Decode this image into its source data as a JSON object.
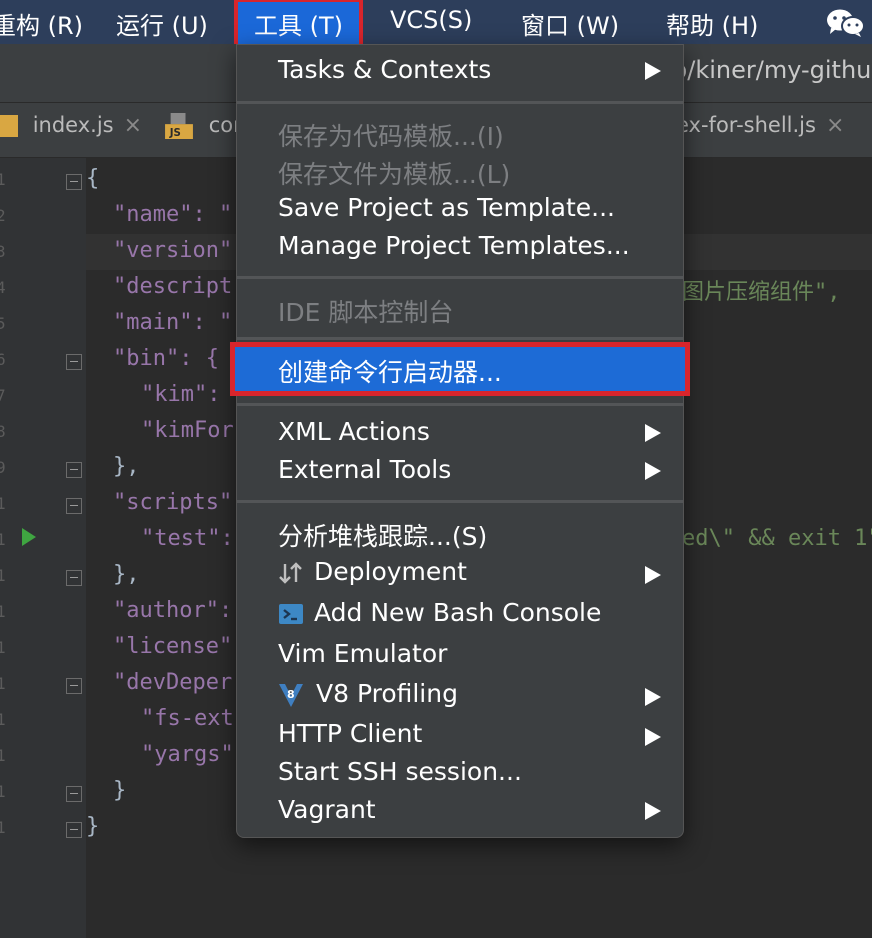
{
  "menubar": {
    "items": [
      {
        "label": "重构 (R)"
      },
      {
        "label": "运行 (U)"
      },
      {
        "label": "工具 (T)"
      },
      {
        "label": "VCS(S)"
      },
      {
        "label": "窗口 (W)"
      },
      {
        "label": "帮助 (H)"
      }
    ],
    "right_icon": "wechat-icon"
  },
  "pathbar": {
    "text": "p/kiner/my-githu"
  },
  "tabs": [
    {
      "label": "index.js",
      "close": "×"
    },
    {
      "label": "con",
      "close": ""
    },
    {
      "label": "ex-for-shell.js",
      "close": "×"
    }
  ],
  "editor": {
    "lines": [
      {
        "left": "{",
        "right": ""
      },
      {
        "left": "\"name\": \"",
        "right": ""
      },
      {
        "left": "\"version\"",
        "right": ""
      },
      {
        "left": "\"descript",
        "right": "图片压缩组件\","
      },
      {
        "left": "\"main\": \"",
        "right": ""
      },
      {
        "left": "\"bin\": {",
        "right": ""
      },
      {
        "left": "\"kim\":",
        "right": ""
      },
      {
        "left": "\"kimFor",
        "right": ""
      },
      {
        "left": "},",
        "right": ""
      },
      {
        "left": "\"scripts\"",
        "right": ""
      },
      {
        "left": "\"test\":",
        "right": "ed\\\" && exit 1\""
      },
      {
        "left": "},",
        "right": ""
      },
      {
        "left": "\"author\":",
        "right": ""
      },
      {
        "left": "\"license\"",
        "right": ""
      },
      {
        "left": "\"devDeper",
        "right": ""
      },
      {
        "left": "\"fs-ext",
        "right": ""
      },
      {
        "left": "\"yargs\"",
        "right": ""
      },
      {
        "left": "}",
        "right": ""
      },
      {
        "left": "}",
        "right": ""
      }
    ]
  },
  "menu": {
    "tasks": "Tasks & Contexts",
    "save_code_template": "保存为代码模板...(I)",
    "save_file_template": "保存文件为模板...(L)",
    "save_project_template": "Save Project as Template...",
    "manage_project_templates": "Manage Project Templates...",
    "ide_console": "IDE 脚本控制台",
    "create_launcher": "创建命令行启动器...",
    "xml_actions": "XML Actions",
    "external_tools": "External Tools",
    "analyze_stack": "分析堆栈跟踪...(S)",
    "deployment": "Deployment",
    "bash_console": "Add New Bash Console",
    "vim_emulator": "Vim Emulator",
    "v8_profiling": "V8 Profiling",
    "http_client": "HTTP Client",
    "ssh_session": "Start SSH session...",
    "vagrant": "Vagrant"
  }
}
